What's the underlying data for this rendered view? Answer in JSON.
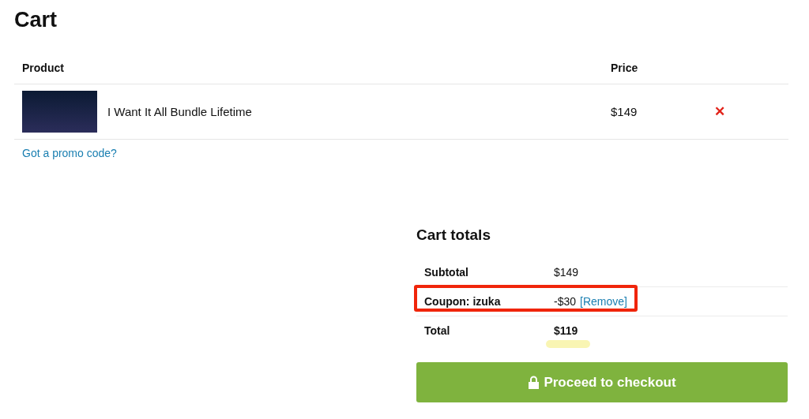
{
  "title": "Cart",
  "table": {
    "columns": [
      "Product",
      "Price"
    ],
    "rows": [
      {
        "product": "I Want It All Bundle Lifetime",
        "price": "$149",
        "remove": "✕"
      }
    ]
  },
  "promo_link": "Got a promo code?",
  "totals": {
    "title": "Cart totals",
    "rows": [
      {
        "kind": "plain",
        "label": "Subtotal",
        "value": "$149",
        "highlighted": false,
        "underlined": false
      },
      {
        "kind": "coupon",
        "label": "Coupon: izuka",
        "value": "-$30",
        "action": "[Remove]",
        "highlighted": true,
        "underlined": false
      },
      {
        "kind": "total",
        "label": "Total",
        "value": "$119",
        "highlighted": false,
        "underlined": true
      }
    ]
  },
  "checkout_button": "Proceed to checkout"
}
